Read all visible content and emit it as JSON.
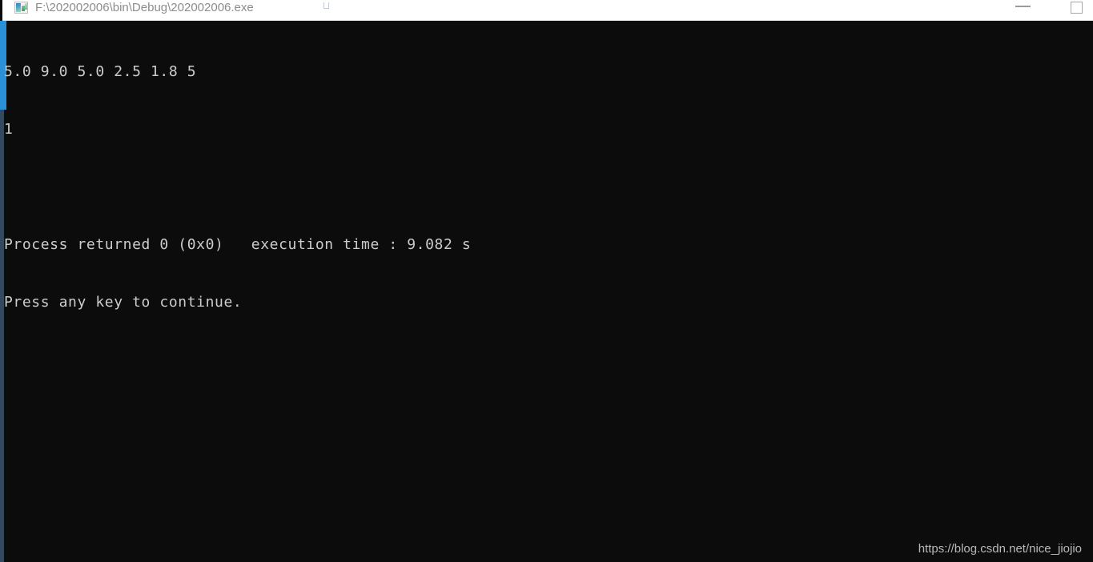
{
  "window": {
    "title": "F:\\202002006\\bin\\Debug\\202002006.exe",
    "icon": "console-app-icon",
    "background_color": "#0c0c0c",
    "titlebar_color": "#ffffff",
    "title_color": "#8c8c8c"
  },
  "window_controls": {
    "minimize_label": "—",
    "minimize_name": "minimize-icon",
    "maximize_label": "□",
    "maximize_name": "maximize-icon"
  },
  "scrollbar": {
    "track_color": "#34495e",
    "thumb_color": "#2a91d8"
  },
  "console": {
    "text_color": "#cccccc",
    "lines": [
      "5.0 9.0 5.0 2.5 1.8 5",
      "1",
      "",
      "Process returned 0 (0x0)   execution time : 9.082 s",
      "Press any key to continue."
    ],
    "output_values": [
      "5.0",
      "9.0",
      "5.0",
      "2.5",
      "1.8",
      "5",
      "1"
    ],
    "return_code": "0",
    "return_code_hex": "0x0",
    "execution_time": "9.082 s",
    "prompt": "Press any key to continue."
  },
  "watermark": {
    "text": "https://blog.csdn.net/nice_jiojio",
    "color": "#b9b9b9"
  }
}
